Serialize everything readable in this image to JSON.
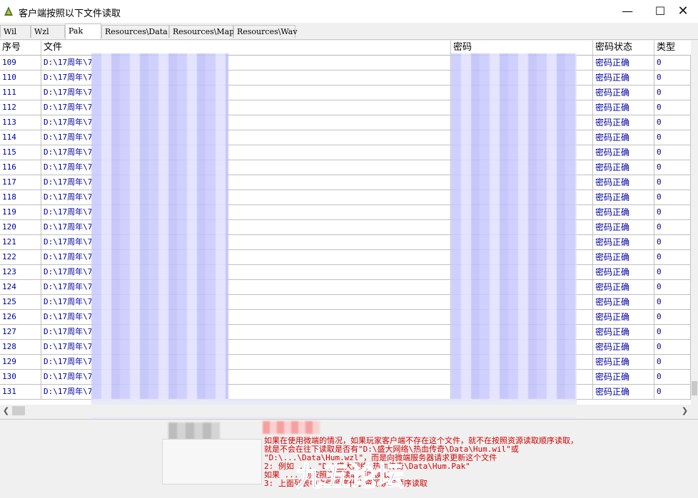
{
  "window": {
    "title": "客户端按照以下文件读取"
  },
  "tabs": [
    {
      "label": "Wil"
    },
    {
      "label": "Wzl"
    },
    {
      "label": "Pak"
    },
    {
      "label": "Resources\\Data"
    },
    {
      "label": "Resources\\Map"
    },
    {
      "label": "Resources\\Wav"
    }
  ],
  "columns": [
    "序号",
    "文件",
    "密码",
    "密码状态",
    "类型"
  ],
  "rows": [
    {
      "seq": "109",
      "file": "D:\\17周年\\7",
      "status": "密码正确",
      "type": "0"
    },
    {
      "seq": "110",
      "file": "D:\\17周年\\7",
      "status": "密码正确",
      "type": "0"
    },
    {
      "seq": "111",
      "file": "D:\\17周年\\7",
      "status": "密码正确",
      "type": "0"
    },
    {
      "seq": "112",
      "file": "D:\\17周年\\7",
      "status": "密码正确",
      "type": "0"
    },
    {
      "seq": "113",
      "file": "D:\\17周年\\7",
      "status": "密码正确",
      "type": "0"
    },
    {
      "seq": "114",
      "file": "D:\\17周年\\7",
      "status": "密码正确",
      "type": "0"
    },
    {
      "seq": "115",
      "file": "D:\\17周年\\7",
      "status": "密码正确",
      "type": "0"
    },
    {
      "seq": "116",
      "file": "D:\\17周年\\7",
      "status": "密码正确",
      "type": "0"
    },
    {
      "seq": "117",
      "file": "D:\\17周年\\7",
      "status": "密码正确",
      "type": "0"
    },
    {
      "seq": "118",
      "file": "D:\\17周年\\7",
      "status": "密码正确",
      "type": "0"
    },
    {
      "seq": "119",
      "file": "D:\\17周年\\7",
      "status": "密码正确",
      "type": "0"
    },
    {
      "seq": "120",
      "file": "D:\\17周年\\7",
      "status": "密码正确",
      "type": "0"
    },
    {
      "seq": "121",
      "file": "D:\\17周年\\7",
      "status": "密码正确",
      "type": "0"
    },
    {
      "seq": "122",
      "file": "D:\\17周年\\7",
      "status": "密码正确",
      "type": "0"
    },
    {
      "seq": "123",
      "file": "D:\\17周年\\7",
      "status": "密码正确",
      "type": "0"
    },
    {
      "seq": "124",
      "file": "D:\\17周年\\7",
      "status": "密码正确",
      "type": "0"
    },
    {
      "seq": "125",
      "file": "D:\\17周年\\7",
      "status": "密码正确",
      "type": "0"
    },
    {
      "seq": "126",
      "file": "D:\\17周年\\7",
      "status": "密码正确",
      "type": "0"
    },
    {
      "seq": "127",
      "file": "D:\\17周年\\7",
      "status": "密码正确",
      "type": "0"
    },
    {
      "seq": "128",
      "file": "D:\\17周年\\7",
      "status": "密码正确",
      "type": "0"
    },
    {
      "seq": "129",
      "file": "D:\\17周年\\7",
      "status": "密码正确",
      "type": "0"
    },
    {
      "seq": "130",
      "file": "D:\\17周年\\7",
      "status": "密码正确",
      "type": "0"
    },
    {
      "seq": "131",
      "file": "D:\\17周年\\7",
      "status": "密码正确",
      "type": "0"
    }
  ],
  "info_lines": [
    "如果在使用微端的情况，如果玩家客户端不存在这个文件，就不在按照资源读取顺序读取，",
    "就是不会在往下读取是否有\"D:\\盛大网络\\热血传奇\\Data\\Hum.wil\"或",
    "\"D:\\...\\Data\\Hum.wzl\"，而是向微端服务器请求更新这个文件",
    "2: 例如 ... \"D:\\盛大网络\\热血传奇\\Data\\Hum.Pak\"",
    "   如果 ... 则按照资源读取顺序读取",
    "3: 上面列表中文件顺序代表资源读取顺序读取"
  ],
  "watermark_text": "九五论坛",
  "colors": {
    "accent": "#0000a0",
    "info_text": "#d00000",
    "blur_fill": "#c8c8ff"
  }
}
